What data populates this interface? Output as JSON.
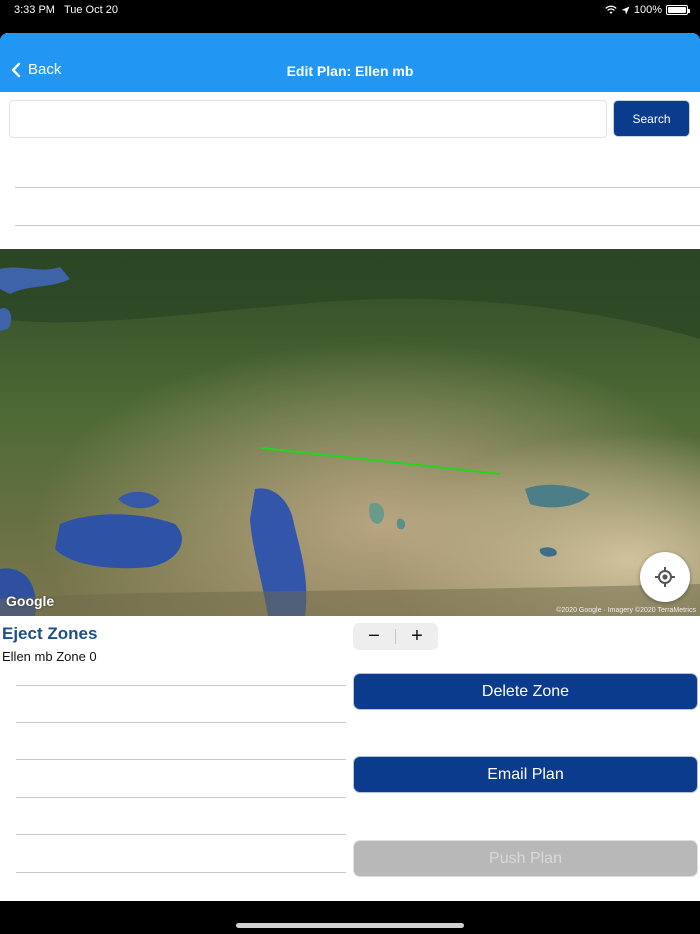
{
  "status_bar": {
    "time": "3:33 PM",
    "date": "Tue Oct 20",
    "battery": "100%"
  },
  "nav": {
    "back_label": "Back",
    "title": "Edit Plan: Ellen mb"
  },
  "search": {
    "placeholder": "",
    "value": "",
    "button_label": "Search"
  },
  "map": {
    "logo": "Google",
    "attribution": "©2020 Google · Imagery ©2020 TerraMetrics",
    "route_color": "#1ed81e"
  },
  "eject_zones": {
    "title": "Eject Zones",
    "items": [
      "Ellen mb Zone 0"
    ],
    "stepper": {
      "minus": "−",
      "plus": "+"
    }
  },
  "actions": {
    "delete_zone": "Delete Zone",
    "email_plan": "Email Plan",
    "push_plan": "Push Plan"
  },
  "colors": {
    "nav_bar": "#2196f3",
    "primary_button": "#0b3b8c",
    "section_title": "#1f4e8c"
  }
}
